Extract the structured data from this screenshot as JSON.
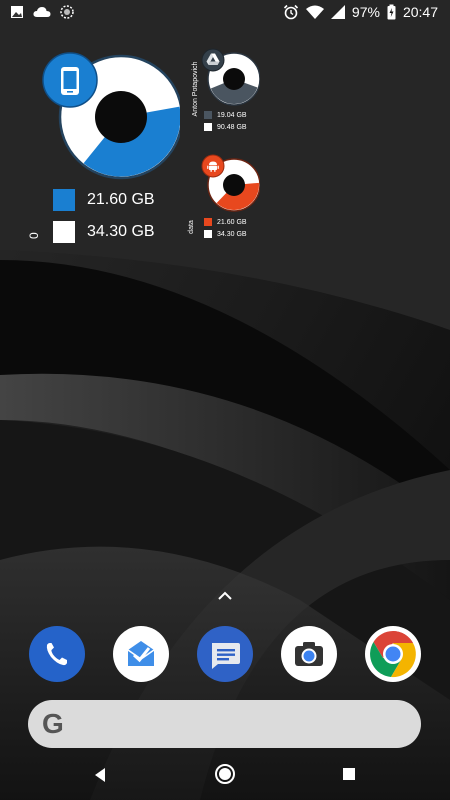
{
  "status_bar": {
    "battery": "97%",
    "time": "20:47"
  },
  "storage_widget_large": {
    "used_percent": 38.6,
    "legend": [
      {
        "label": "21.60 GB",
        "color": "#1a7fd1"
      },
      {
        "label": "34.30 GB",
        "color": "#ffffff"
      }
    ],
    "side_label": "0"
  },
  "drive_widget": {
    "account_name": "Anton Potapovich",
    "used_percent": 17.4,
    "legend": [
      {
        "label": "19.04 GB",
        "color": "#4a5560"
      },
      {
        "label": "90.48 GB",
        "color": "#ffffff"
      }
    ]
  },
  "data_widget": {
    "title": "data",
    "used_percent": 38.6,
    "legend": [
      {
        "label": "21.60 GB",
        "color": "#e8481e"
      },
      {
        "label": "34.30 GB",
        "color": "#ffffff"
      }
    ]
  },
  "dock": {
    "apps": [
      "Phone",
      "Inbox",
      "Messages",
      "Camera",
      "Chrome"
    ]
  },
  "search": {
    "logo_letter": "G"
  }
}
